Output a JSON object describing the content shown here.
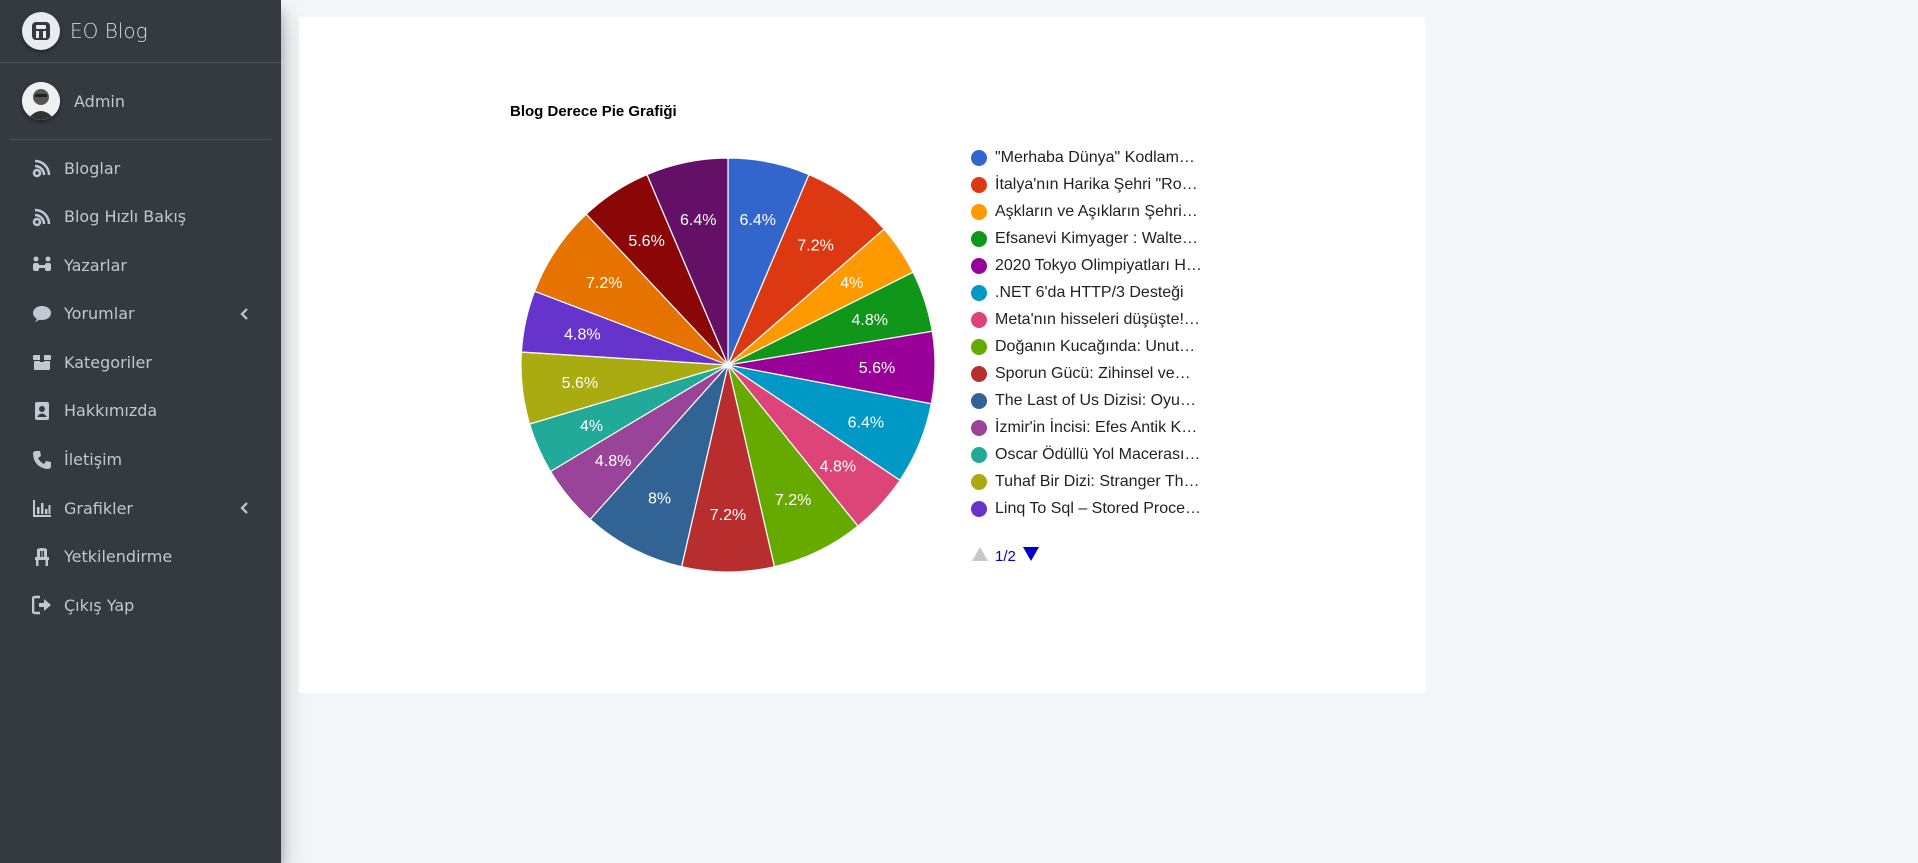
{
  "brand": {
    "name": "EO Blog"
  },
  "user": {
    "name": "Admin"
  },
  "sidebar": {
    "items": [
      {
        "label": "Bloglar",
        "icon": "blog-icon"
      },
      {
        "label": "Blog Hızlı Bakış",
        "icon": "blog-icon"
      },
      {
        "label": "Yazarlar",
        "icon": "users-icon"
      },
      {
        "label": "Yorumlar",
        "icon": "comment-icon",
        "expandable": true
      },
      {
        "label": "Kategoriler",
        "icon": "box-icon"
      },
      {
        "label": "Hakkımızda",
        "icon": "address-book-icon"
      },
      {
        "label": "İletişim",
        "icon": "phone-icon"
      },
      {
        "label": "Grafikler",
        "icon": "chart-icon",
        "expandable": true
      },
      {
        "label": "Yetkilendirme",
        "icon": "chair-icon"
      },
      {
        "label": "Çıkış Yap",
        "icon": "sign-out-icon"
      }
    ]
  },
  "pager": {
    "text": "1/2"
  },
  "chart_data": {
    "type": "pie",
    "title": "Blog Derece Pie Grafiği",
    "legend_position": "right",
    "slices": [
      {
        "label": "\"Merhaba Dünya\" Kodlam…",
        "value": 6.4,
        "display": "6.4%",
        "color": "#3366cc"
      },
      {
        "label": "İtalya'nın Harika Şehri \"Ro…",
        "value": 7.2,
        "display": "7.2%",
        "color": "#dc3912"
      },
      {
        "label": "Aşkların ve Aşıkların Şehri…",
        "value": 4.0,
        "display": "4%",
        "color": "#ff9900"
      },
      {
        "label": "Efsanevi Kimyager : Walte…",
        "value": 4.8,
        "display": "4.8%",
        "color": "#109618"
      },
      {
        "label": "2020 Tokyo Olimpiyatları H…",
        "value": 5.6,
        "display": "5.6%",
        "color": "#990099"
      },
      {
        "label": ".NET 6'da HTTP/3 Desteği",
        "value": 6.4,
        "display": "6.4%",
        "color": "#0099c6"
      },
      {
        "label": "Meta'nın hisseleri düşüşte!…",
        "value": 4.8,
        "display": "4.8%",
        "color": "#dd4477"
      },
      {
        "label": "Doğanın Kucağında: Unut…",
        "value": 7.2,
        "display": "7.2%",
        "color": "#66aa00"
      },
      {
        "label": "Sporun Gücü: Zihinsel ve…",
        "value": 7.2,
        "display": "7.2%",
        "color": "#b82e2e"
      },
      {
        "label": "The Last of Us Dizisi: Oyu…",
        "value": 8.0,
        "display": "8%",
        "color": "#316395"
      },
      {
        "label": "İzmir'in İncisi: Efes Antik K…",
        "value": 4.8,
        "display": "4.8%",
        "color": "#994499"
      },
      {
        "label": "Oscar Ödüllü Yol Macerası…",
        "value": 4.0,
        "display": "4%",
        "color": "#22aa99"
      },
      {
        "label": "Tuhaf Bir Dizi: Stranger Th…",
        "value": 5.6,
        "display": "5.6%",
        "color": "#aaaa11"
      },
      {
        "label": "Linq To Sql – Stored Proce…",
        "value": 4.8,
        "display": "4.8%",
        "color": "#6633cc"
      },
      {
        "label": "",
        "value": 7.2,
        "display": "7.2%",
        "color": "#e67300",
        "in_legend": false
      },
      {
        "label": "",
        "value": 5.6,
        "display": "5.6%",
        "color": "#8b0707",
        "in_legend": false
      },
      {
        "label": "",
        "value": 6.4,
        "display": "6.4%",
        "color": "#651067",
        "in_legend": false
      }
    ]
  }
}
